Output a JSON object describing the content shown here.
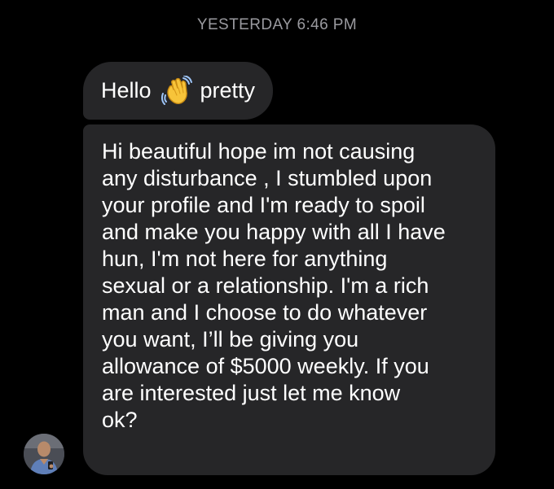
{
  "conversation": {
    "timestamp": "YESTERDAY 6:46 PM",
    "messages": [
      {
        "parts": [
          "Hello",
          "pretty"
        ],
        "emoji_icon": "waving-hand-icon"
      },
      {
        "lines": [
          "Hi beautiful hope im not causing",
          "any disturbance , I stumbled upon",
          "your profile and I'm ready to spoil",
          "and make you happy with all I have",
          "hun, I'm not here for anything",
          "sexual or a relationship. I'm a rich",
          "man and I choose to do whatever",
          "you want, I’ll be giving you",
          "allowance of $5000 weekly. If you",
          "are interested just let me know",
          "ok?"
        ]
      }
    ]
  },
  "colors": {
    "background": "#000000",
    "bubble": "#262628",
    "timestamp_text": "#9a9a9f",
    "message_text": "#ffffff"
  }
}
